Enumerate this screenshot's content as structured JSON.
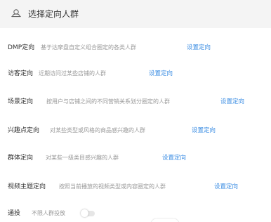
{
  "header": {
    "title": "选择定向人群",
    "icon": "crowd-icon"
  },
  "rules": [
    {
      "label": "DMP定向",
      "description": "基于达摩盘自定义组合圈定的各类人群",
      "link": "设置定向"
    },
    {
      "label": "访客定向",
      "description": "近期访问过某些店铺的人群",
      "link": "设置定向"
    },
    {
      "label": "场景定向",
      "description": "按用户与店铺之间的不同营销关系划分圈定的人群",
      "link": "设置定向"
    },
    {
      "label": "兴趣点定向",
      "description": "对某些类型或风格的商品感兴趣的人群",
      "link": "设置定向"
    },
    {
      "label": "群体定向",
      "description": "对某些一级类目感兴趣的人群",
      "link": "设置定向"
    },
    {
      "label": "视频主题定向",
      "description": "按照当前播放的视频类型或内容圈定的人群",
      "link": "设置定向"
    }
  ],
  "general": {
    "label": "通投",
    "description": "不限人群投放",
    "toggle_on": false
  },
  "colors": {
    "link": "#3b8de3",
    "header_bg": "#f4f4f4"
  }
}
